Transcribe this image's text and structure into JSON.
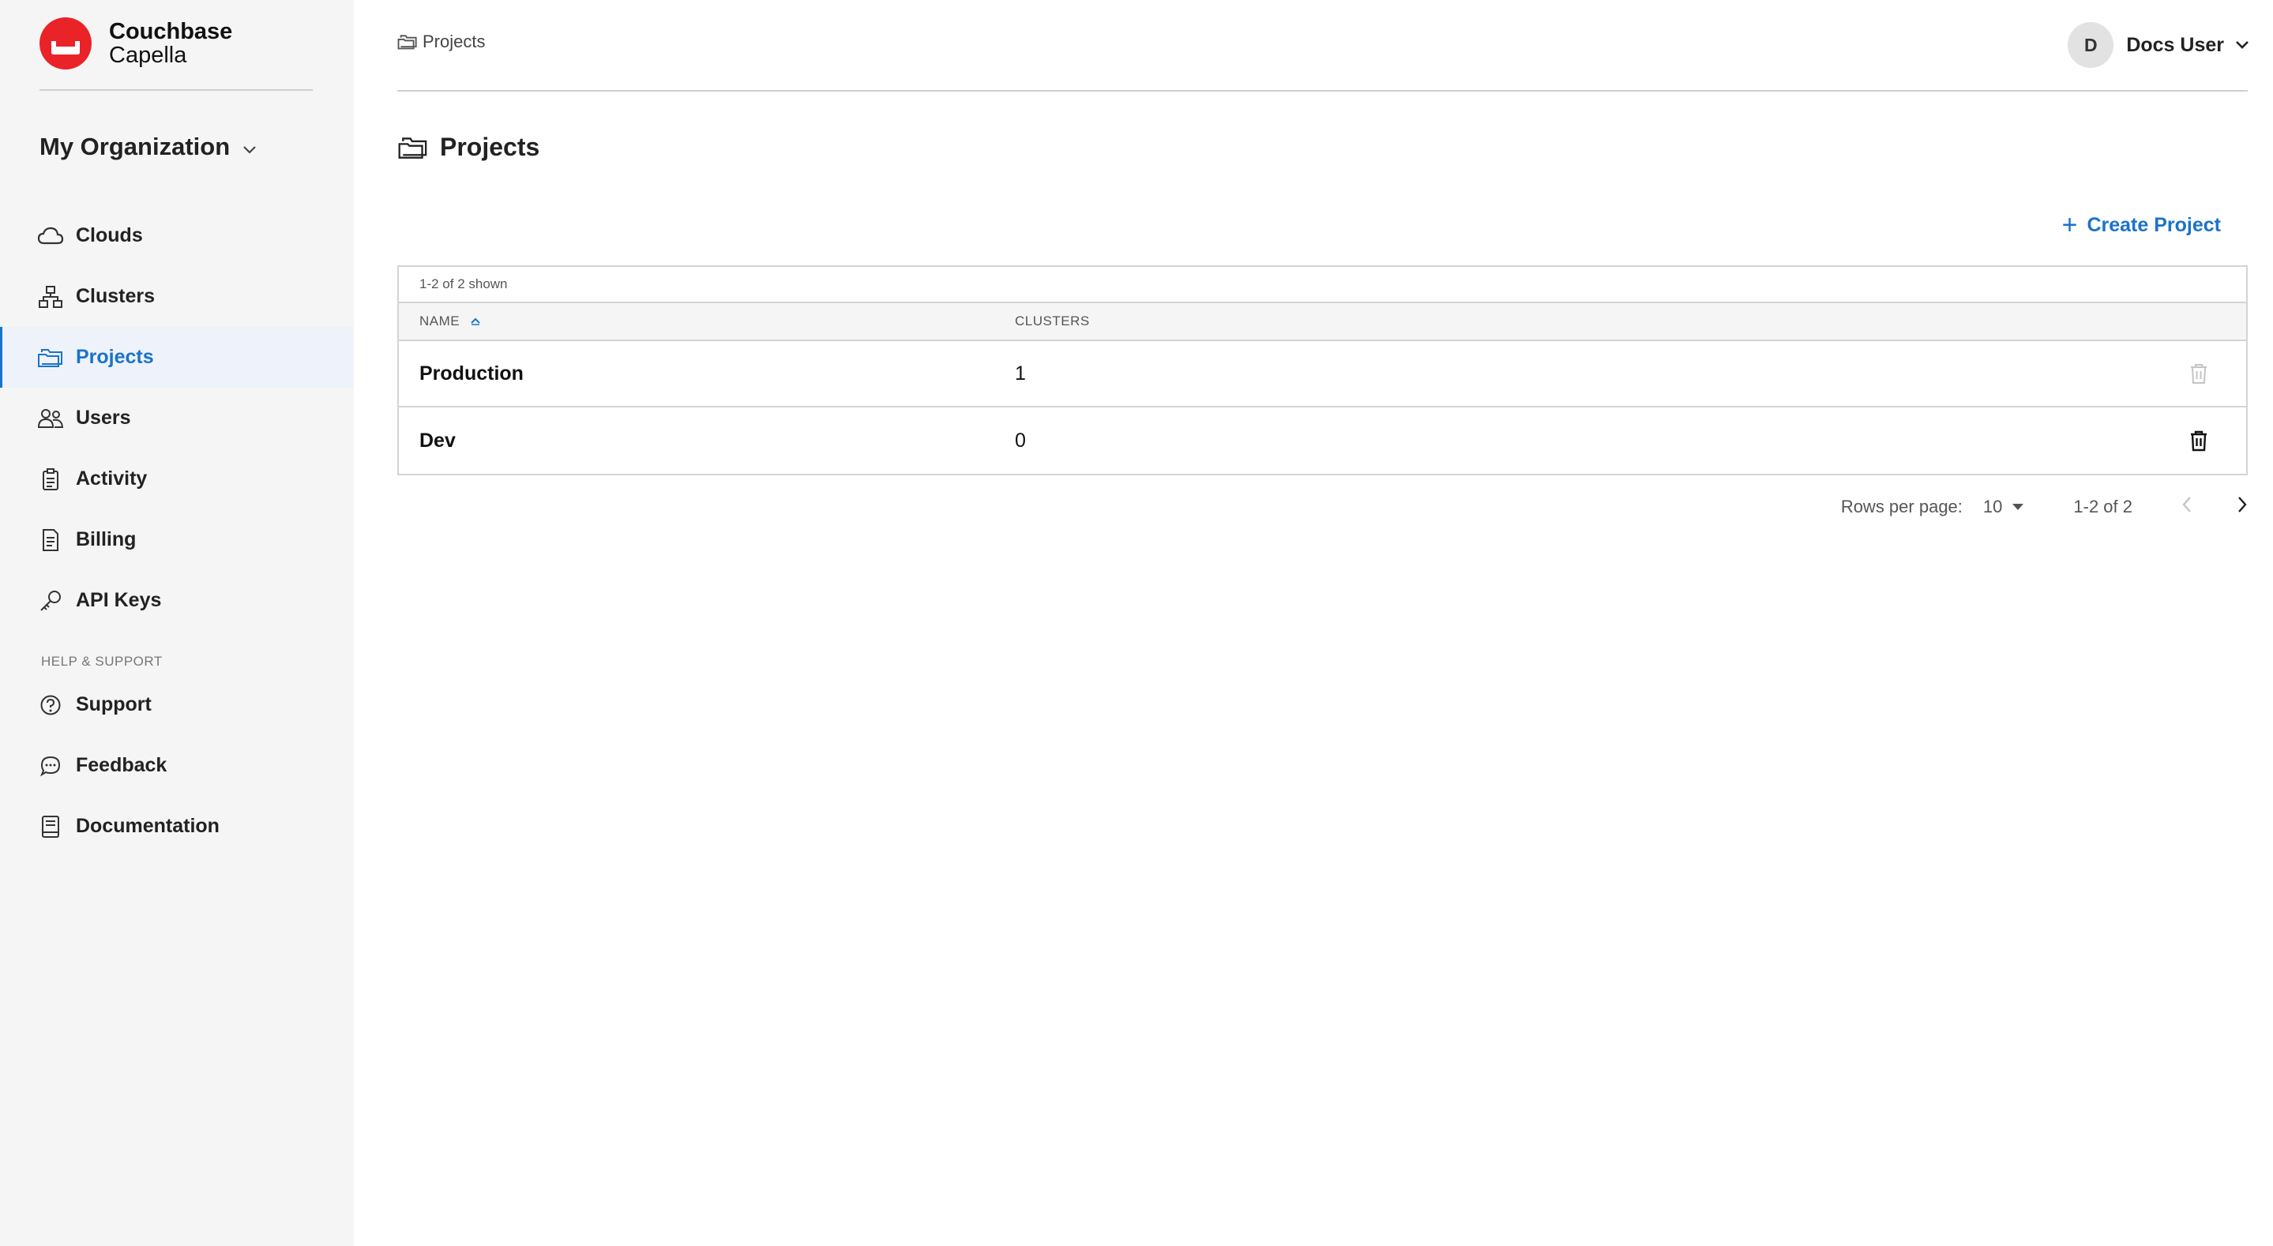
{
  "brand": {
    "name": "Couchbase",
    "product": "Capella",
    "color": "#ea2328"
  },
  "org": {
    "label": "My Organization"
  },
  "nav": {
    "items": [
      {
        "label": "Clouds",
        "icon": "cloud-icon"
      },
      {
        "label": "Clusters",
        "icon": "clusters-icon"
      },
      {
        "label": "Projects",
        "icon": "folder-icon",
        "active": true
      },
      {
        "label": "Users",
        "icon": "users-icon"
      },
      {
        "label": "Activity",
        "icon": "activity-icon"
      },
      {
        "label": "Billing",
        "icon": "billing-icon"
      },
      {
        "label": "API Keys",
        "icon": "key-icon"
      }
    ],
    "section_label": "HELP & SUPPORT",
    "help_items": [
      {
        "label": "Support",
        "icon": "help-circle-icon"
      },
      {
        "label": "Feedback",
        "icon": "chat-icon"
      },
      {
        "label": "Documentation",
        "icon": "book-icon"
      }
    ]
  },
  "header": {
    "breadcrumb": "Projects",
    "user": {
      "initial": "D",
      "name": "Docs User"
    }
  },
  "page": {
    "title": "Projects"
  },
  "actions": {
    "create_label": "Create Project"
  },
  "table": {
    "count_text": "1-2 of 2 shown",
    "columns": {
      "name": "NAME",
      "clusters": "CLUSTERS"
    },
    "rows": [
      {
        "name": "Production",
        "clusters": "1",
        "delete_enabled": false
      },
      {
        "name": "Dev",
        "clusters": "0",
        "delete_enabled": true
      }
    ]
  },
  "pagination": {
    "rows_per_page_label": "Rows per page:",
    "rows_per_page_value": "10",
    "range": "1-2 of 2"
  },
  "colors": {
    "accent": "#1a73c8",
    "text": "#222222",
    "sidebar_bg": "#f5f5f5"
  }
}
